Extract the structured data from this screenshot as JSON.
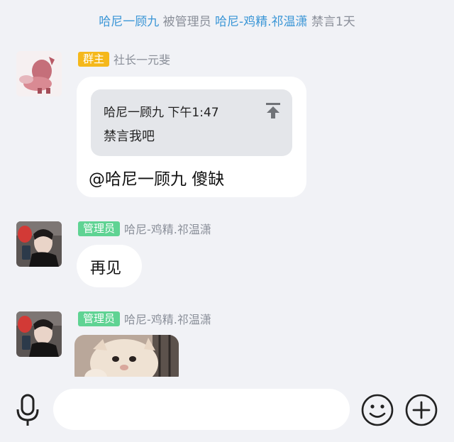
{
  "system_notice": {
    "target_user": "哈尼一顾九",
    "text_1": "被管理员",
    "admin_user": "哈尼-鸡精.祁温潇",
    "text_2": "禁言1天"
  },
  "messages": [
    {
      "role_badge": "群主",
      "role_color": "#f5b81b",
      "sender": "社长一元斐",
      "quote": {
        "header": "哈尼一顾九 下午1:47",
        "text": "禁言我吧"
      },
      "text": "@哈尼一顾九 傻缺"
    },
    {
      "role_badge": "管理员",
      "role_color": "#5fd393",
      "sender": "哈尼-鸡精.祁温潇",
      "text": "再见"
    },
    {
      "role_badge": "管理员",
      "role_color": "#5fd393",
      "sender": "哈尼-鸡精.祁温潇",
      "image": "cat-photo"
    }
  ],
  "input_bar": {
    "placeholder": "",
    "icons": [
      "microphone-icon",
      "emoji-icon",
      "plus-icon"
    ]
  }
}
